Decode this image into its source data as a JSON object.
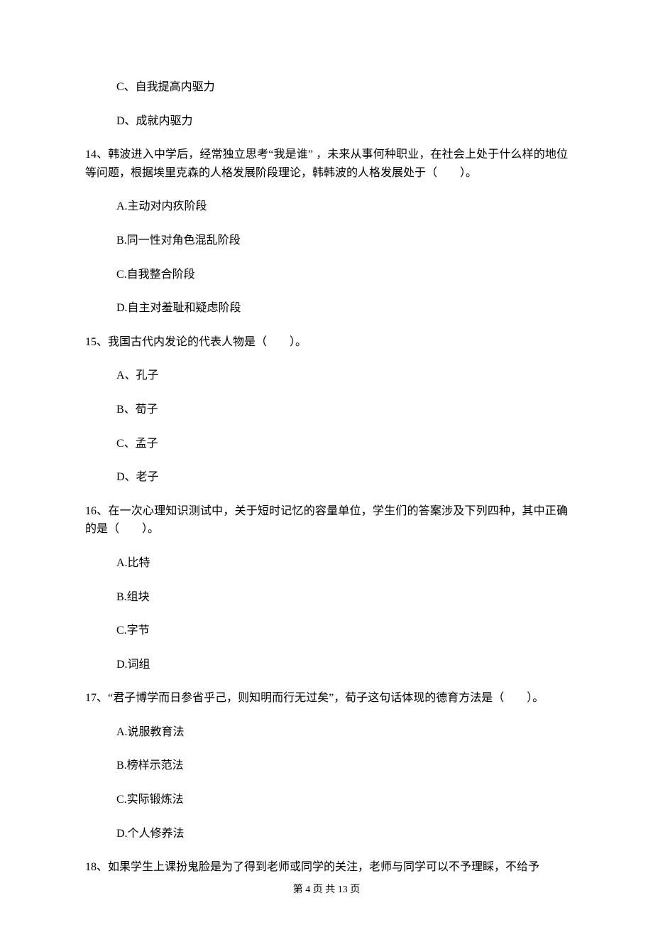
{
  "q13": {
    "optC": "C、自我提高内驱力",
    "optD": "D、成就内驱力"
  },
  "q14": {
    "stem": "14、韩波进入中学后，经常独立思考“我是谁” ，未来从事何种职业，在社会上处于什么样的地位等问题，根据埃里克森的人格发展阶段理论，韩韩波的人格发展处于（　　）。",
    "optA": "A.主动对内疚阶段",
    "optB": "B.同一性对角色混乱阶段",
    "optC": "C.自我整合阶段",
    "optD": "D.自主对羞耻和疑虑阶段"
  },
  "q15": {
    "stem": "15、我国古代内发论的代表人物是（　　）。",
    "optA": "A、孔子",
    "optB": "B、荀子",
    "optC": "C、孟子",
    "optD": "D、老子"
  },
  "q16": {
    "stem": "16、在一次心理知识测试中，关于短时记忆的容量单位，学生们的答案涉及下列四种，其中正确的是（　　）。",
    "optA": "A.比特",
    "optB": "B.组块",
    "optC": "C.字节",
    "optD": "D.词组"
  },
  "q17": {
    "stem": "17、“君子博学而日参省乎己，则知明而行无过矣”，荀子这句话体现的德育方法是（　　）。",
    "optA": "A.说服教育法",
    "optB": "B.榜样示范法",
    "optC": "C.实际锻炼法",
    "optD": "D.个人修养法"
  },
  "q18": {
    "stem": "18、如果学生上课扮鬼脸是为了得到老师或同学的关注，老师与同学可以不予理睬，不给予"
  },
  "footer": "第 4 页 共 13 页"
}
